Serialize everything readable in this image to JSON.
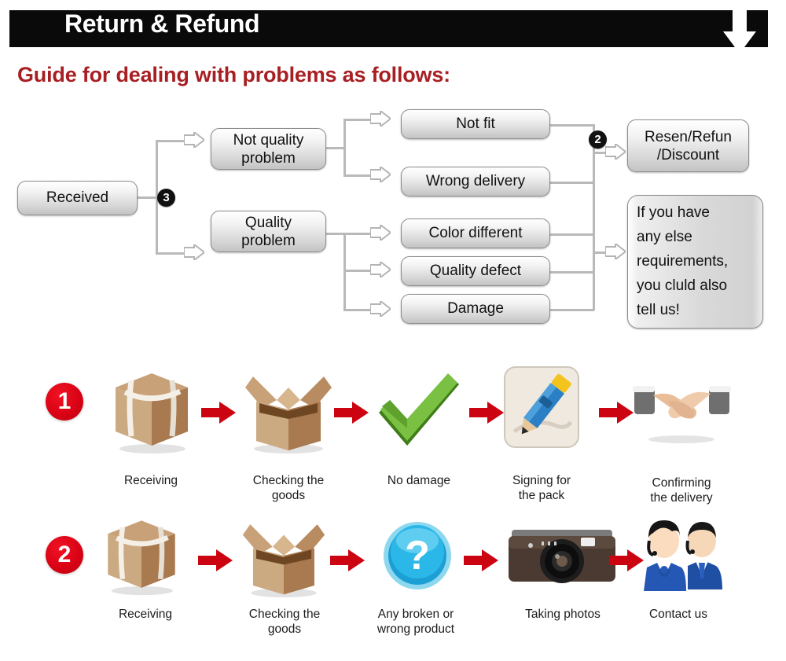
{
  "header": {
    "title": "Return & Refund",
    "arrow_icon": "down-arrow-icon",
    "bar_color": "#0a0a0a",
    "title_color": "#ffffff"
  },
  "guide": {
    "title": "Guide for dealing with problems as follows:",
    "color": "#a81f23"
  },
  "flowchart": {
    "nodes": {
      "received": "Received",
      "not_quality_problem": "Not quality\nproblem",
      "quality_problem": "Quality\nproblem",
      "not_fit": "Not fit",
      "wrong_delivery": "Wrong delivery",
      "color_different": "Color different",
      "quality_defect": "Quality defect",
      "damage": "Damage",
      "resend_refund": "Resen/Refun\n/Discount",
      "note": "If you have any else requirements, you cluld also tell us!"
    },
    "note_lines": [
      "If you have",
      "any else",
      "requirements,",
      "you cluld also",
      "tell us!"
    ],
    "resend_lines": [
      "Resen/Refun",
      "/Discount"
    ],
    "not_quality_lines": [
      "Not quality",
      "problem"
    ],
    "quality_lines": [
      "Quality",
      "problem"
    ],
    "badges": {
      "branch_three": "3",
      "branch_two": "2"
    }
  },
  "process": {
    "row1": {
      "badge": "1",
      "steps": [
        {
          "icon": "sealed-box-icon",
          "label_lines": [
            "Receiving"
          ]
        },
        {
          "icon": "open-box-icon",
          "label_lines": [
            "Checking the",
            "goods"
          ]
        },
        {
          "icon": "green-check-icon",
          "label_lines": [
            "No damage"
          ]
        },
        {
          "icon": "pencil-signing-icon",
          "label_lines": [
            "Signing for",
            "the pack"
          ]
        },
        {
          "icon": "handshake-icon",
          "label_lines": [
            "Confirming",
            "the delivery"
          ]
        }
      ]
    },
    "row2": {
      "badge": "2",
      "steps": [
        {
          "icon": "sealed-box-icon",
          "label_lines": [
            "Receiving"
          ]
        },
        {
          "icon": "open-box-icon",
          "label_lines": [
            "Checking the",
            "goods"
          ]
        },
        {
          "icon": "blue-question-icon",
          "label_lines": [
            "Any broken or",
            "wrong product"
          ]
        },
        {
          "icon": "camera-icon",
          "label_lines": [
            "Taking photos"
          ]
        },
        {
          "icon": "support-agents-icon",
          "label_lines": [
            "Contact us"
          ]
        }
      ]
    },
    "arrow_icon": "red-right-arrow-icon",
    "arrow_color": "#cc0411",
    "badge_color": "#da0215"
  }
}
